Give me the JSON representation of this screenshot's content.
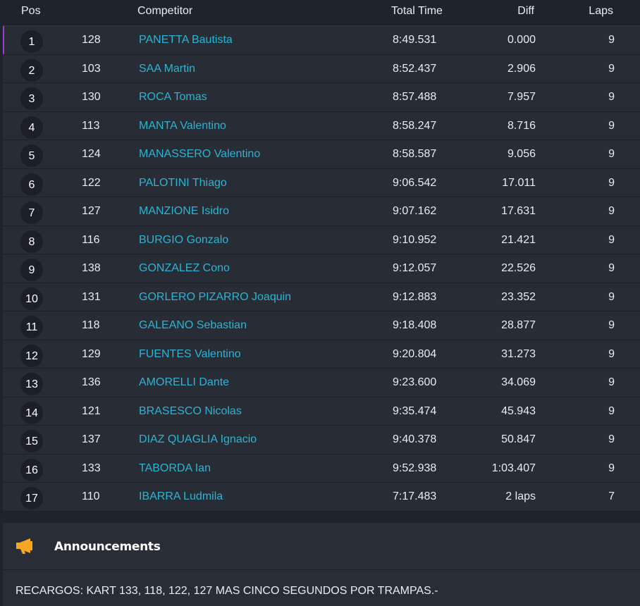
{
  "table": {
    "headers": {
      "pos": "Pos",
      "competitor": "Competitor",
      "total_time": "Total Time",
      "diff": "Diff",
      "laps": "Laps"
    },
    "rows": [
      {
        "pos": "1",
        "no": "128",
        "name": "PANETTA Bautista",
        "time": "8:49.531",
        "diff": "0.000",
        "laps": "9"
      },
      {
        "pos": "2",
        "no": "103",
        "name": "SAA Martin",
        "time": "8:52.437",
        "diff": "2.906",
        "laps": "9"
      },
      {
        "pos": "3",
        "no": "130",
        "name": "ROCA Tomas",
        "time": "8:57.488",
        "diff": "7.957",
        "laps": "9"
      },
      {
        "pos": "4",
        "no": "113",
        "name": "MANTA Valentino",
        "time": "8:58.247",
        "diff": "8.716",
        "laps": "9"
      },
      {
        "pos": "5",
        "no": "124",
        "name": "MANASSERO Valentino",
        "time": "8:58.587",
        "diff": "9.056",
        "laps": "9"
      },
      {
        "pos": "6",
        "no": "122",
        "name": "PALOTINI Thiago",
        "time": "9:06.542",
        "diff": "17.011",
        "laps": "9"
      },
      {
        "pos": "7",
        "no": "127",
        "name": "MANZIONE Isidro",
        "time": "9:07.162",
        "diff": "17.631",
        "laps": "9"
      },
      {
        "pos": "8",
        "no": "116",
        "name": "BURGIO Gonzalo",
        "time": "9:10.952",
        "diff": "21.421",
        "laps": "9"
      },
      {
        "pos": "9",
        "no": "138",
        "name": "GONZALEZ Cono",
        "time": "9:12.057",
        "diff": "22.526",
        "laps": "9"
      },
      {
        "pos": "10",
        "no": "131",
        "name": "GORLERO PIZARRO Joaquin",
        "time": "9:12.883",
        "diff": "23.352",
        "laps": "9"
      },
      {
        "pos": "11",
        "no": "118",
        "name": "GALEANO Sebastian",
        "time": "9:18.408",
        "diff": "28.877",
        "laps": "9"
      },
      {
        "pos": "12",
        "no": "129",
        "name": "FUENTES Valentino",
        "time": "9:20.804",
        "diff": "31.273",
        "laps": "9"
      },
      {
        "pos": "13",
        "no": "136",
        "name": "AMORELLI Dante",
        "time": "9:23.600",
        "diff": "34.069",
        "laps": "9"
      },
      {
        "pos": "14",
        "no": "121",
        "name": "BRASESCO Nicolas",
        "time": "9:35.474",
        "diff": "45.943",
        "laps": "9"
      },
      {
        "pos": "15",
        "no": "137",
        "name": "DIAZ QUAGLIA Ignacio",
        "time": "9:40.378",
        "diff": "50.847",
        "laps": "9"
      },
      {
        "pos": "16",
        "no": "133",
        "name": "TABORDA Ian",
        "time": "9:52.938",
        "diff": "1:03.407",
        "laps": "9"
      },
      {
        "pos": "17",
        "no": "110",
        "name": "IBARRA Ludmila",
        "time": "7:17.483",
        "diff": "2 laps",
        "laps": "7"
      }
    ]
  },
  "announcements": {
    "icon": "megaphone-icon",
    "title": "Announcements",
    "text": "RECARGOS: KART 133, 118, 122, 127 MAS CINCO SEGUNDOS POR TRAMPAS.-"
  },
  "colors": {
    "leader_accent": "#a23bd1",
    "competitor_link": "#2fb3d4",
    "megaphone": "#f5a623"
  }
}
